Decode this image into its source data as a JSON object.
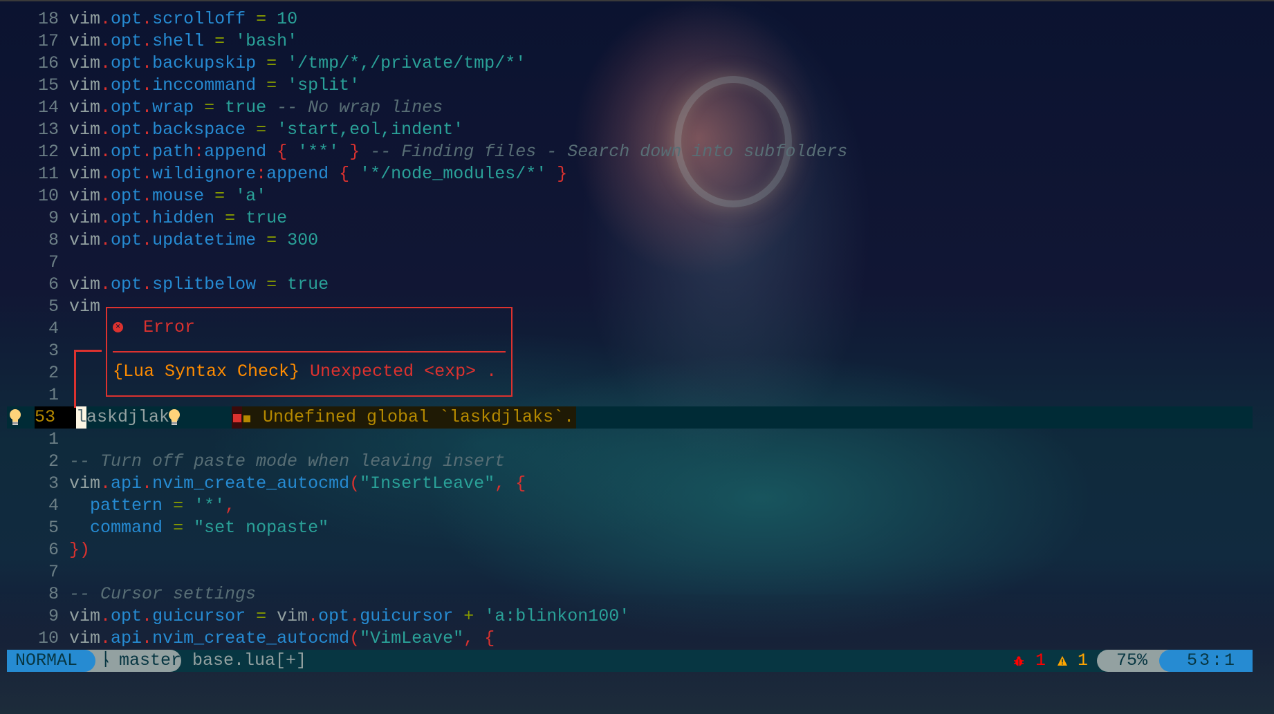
{
  "editor": {
    "lines_above": [
      {
        "num": "18",
        "tokens": [
          [
            "v",
            "vim"
          ],
          [
            "d",
            "."
          ],
          [
            "p",
            "opt"
          ],
          [
            "d",
            "."
          ],
          [
            "p",
            "scrolloff"
          ],
          [
            "v",
            " "
          ],
          [
            "o",
            "="
          ],
          [
            "v",
            " "
          ],
          [
            "s",
            "10"
          ]
        ]
      },
      {
        "num": "17",
        "tokens": [
          [
            "v",
            "vim"
          ],
          [
            "d",
            "."
          ],
          [
            "p",
            "opt"
          ],
          [
            "d",
            "."
          ],
          [
            "p",
            "shell"
          ],
          [
            "v",
            " "
          ],
          [
            "o",
            "="
          ],
          [
            "v",
            " "
          ],
          [
            "s",
            "'bash'"
          ]
        ]
      },
      {
        "num": "16",
        "tokens": [
          [
            "v",
            "vim"
          ],
          [
            "d",
            "."
          ],
          [
            "p",
            "opt"
          ],
          [
            "d",
            "."
          ],
          [
            "p",
            "backupskip"
          ],
          [
            "v",
            " "
          ],
          [
            "o",
            "="
          ],
          [
            "v",
            " "
          ],
          [
            "s",
            "'/tmp/*,/private/tmp/*'"
          ]
        ]
      },
      {
        "num": "15",
        "tokens": [
          [
            "v",
            "vim"
          ],
          [
            "d",
            "."
          ],
          [
            "p",
            "opt"
          ],
          [
            "d",
            "."
          ],
          [
            "p",
            "inccommand"
          ],
          [
            "v",
            " "
          ],
          [
            "o",
            "="
          ],
          [
            "v",
            " "
          ],
          [
            "s",
            "'split'"
          ]
        ]
      },
      {
        "num": "14",
        "tokens": [
          [
            "v",
            "vim"
          ],
          [
            "d",
            "."
          ],
          [
            "p",
            "opt"
          ],
          [
            "d",
            "."
          ],
          [
            "p",
            "wrap"
          ],
          [
            "v",
            " "
          ],
          [
            "o",
            "="
          ],
          [
            "v",
            " "
          ],
          [
            "s",
            "true"
          ],
          [
            "v",
            " "
          ],
          [
            "c",
            "-- No wrap lines"
          ]
        ]
      },
      {
        "num": "13",
        "tokens": [
          [
            "v",
            "vim"
          ],
          [
            "d",
            "."
          ],
          [
            "p",
            "opt"
          ],
          [
            "d",
            "."
          ],
          [
            "p",
            "backspace"
          ],
          [
            "v",
            " "
          ],
          [
            "o",
            "="
          ],
          [
            "v",
            " "
          ],
          [
            "s",
            "'start,eol,indent'"
          ]
        ]
      },
      {
        "num": "12",
        "tokens": [
          [
            "v",
            "vim"
          ],
          [
            "d",
            "."
          ],
          [
            "p",
            "opt"
          ],
          [
            "d",
            "."
          ],
          [
            "p",
            "path"
          ],
          [
            "d",
            ":"
          ],
          [
            "p",
            "append"
          ],
          [
            "v",
            " "
          ],
          [
            "b",
            "{"
          ],
          [
            "v",
            " "
          ],
          [
            "s",
            "'**'"
          ],
          [
            "v",
            " "
          ],
          [
            "b",
            "}"
          ],
          [
            "v",
            " "
          ],
          [
            "c",
            "-- Finding files - Search down into subfolders"
          ]
        ]
      },
      {
        "num": "11",
        "tokens": [
          [
            "v",
            "vim"
          ],
          [
            "d",
            "."
          ],
          [
            "p",
            "opt"
          ],
          [
            "d",
            "."
          ],
          [
            "p",
            "wildignore"
          ],
          [
            "d",
            ":"
          ],
          [
            "p",
            "append"
          ],
          [
            "v",
            " "
          ],
          [
            "b",
            "{"
          ],
          [
            "v",
            " "
          ],
          [
            "s",
            "'*/node_modules/*'"
          ],
          [
            "v",
            " "
          ],
          [
            "b",
            "}"
          ]
        ]
      },
      {
        "num": "10",
        "tokens": [
          [
            "v",
            "vim"
          ],
          [
            "d",
            "."
          ],
          [
            "p",
            "opt"
          ],
          [
            "d",
            "."
          ],
          [
            "p",
            "mouse"
          ],
          [
            "v",
            " "
          ],
          [
            "o",
            "="
          ],
          [
            "v",
            " "
          ],
          [
            "s",
            "'a'"
          ]
        ]
      },
      {
        "num": "9",
        "tokens": [
          [
            "v",
            "vim"
          ],
          [
            "d",
            "."
          ],
          [
            "p",
            "opt"
          ],
          [
            "d",
            "."
          ],
          [
            "p",
            "hidden"
          ],
          [
            "v",
            " "
          ],
          [
            "o",
            "="
          ],
          [
            "v",
            " "
          ],
          [
            "s",
            "true"
          ]
        ]
      },
      {
        "num": "8",
        "tokens": [
          [
            "v",
            "vim"
          ],
          [
            "d",
            "."
          ],
          [
            "p",
            "opt"
          ],
          [
            "d",
            "."
          ],
          [
            "p",
            "updatetime"
          ],
          [
            "v",
            " "
          ],
          [
            "o",
            "="
          ],
          [
            "v",
            " "
          ],
          [
            "s",
            "300"
          ]
        ]
      },
      {
        "num": "7",
        "tokens": []
      },
      {
        "num": "6",
        "tokens": [
          [
            "v",
            "vim"
          ],
          [
            "d",
            "."
          ],
          [
            "p",
            "opt"
          ],
          [
            "d",
            "."
          ],
          [
            "p",
            "splitbelow"
          ],
          [
            "v",
            " "
          ],
          [
            "o",
            "="
          ],
          [
            "v",
            " "
          ],
          [
            "s",
            "true"
          ]
        ]
      },
      {
        "num": "5",
        "tokens": [
          [
            "v",
            "vim"
          ]
        ]
      },
      {
        "num": "4",
        "tokens": []
      },
      {
        "num": "3",
        "tokens": []
      },
      {
        "num": "2",
        "tokens": []
      },
      {
        "num": "1",
        "tokens": []
      }
    ],
    "cursor_line": {
      "num": "53",
      "cursor_char": "l",
      "rest_text": "askdjlaks",
      "diagnostic_text": "Undefined global `laskdjlaks`."
    },
    "lines_below": [
      {
        "num": "1",
        "tokens": []
      },
      {
        "num": "2",
        "tokens": [
          [
            "c",
            "-- Turn off paste mode when leaving insert"
          ]
        ]
      },
      {
        "num": "3",
        "tokens": [
          [
            "v",
            "vim"
          ],
          [
            "d",
            "."
          ],
          [
            "p",
            "api"
          ],
          [
            "d",
            "."
          ],
          [
            "p",
            "nvim_create_autocmd"
          ],
          [
            "b",
            "("
          ],
          [
            "s",
            "\"InsertLeave\""
          ],
          [
            "d",
            ","
          ],
          [
            "v",
            " "
          ],
          [
            "b",
            "{"
          ]
        ]
      },
      {
        "num": "4",
        "tokens": [
          [
            "v",
            "  "
          ],
          [
            "p",
            "pattern"
          ],
          [
            "v",
            " "
          ],
          [
            "o",
            "="
          ],
          [
            "v",
            " "
          ],
          [
            "s",
            "'*'"
          ],
          [
            "d",
            ","
          ]
        ]
      },
      {
        "num": "5",
        "tokens": [
          [
            "v",
            "  "
          ],
          [
            "p",
            "command"
          ],
          [
            "v",
            " "
          ],
          [
            "o",
            "="
          ],
          [
            "v",
            " "
          ],
          [
            "s",
            "\"set nopaste\""
          ]
        ]
      },
      {
        "num": "6",
        "tokens": [
          [
            "b",
            "})"
          ]
        ]
      },
      {
        "num": "7",
        "tokens": []
      },
      {
        "num": "8",
        "tokens": [
          [
            "c",
            "-- Cursor settings"
          ]
        ]
      },
      {
        "num": "9",
        "tokens": [
          [
            "v",
            "vim"
          ],
          [
            "d",
            "."
          ],
          [
            "p",
            "opt"
          ],
          [
            "d",
            "."
          ],
          [
            "p",
            "guicursor"
          ],
          [
            "v",
            " "
          ],
          [
            "o",
            "="
          ],
          [
            "v",
            " vim"
          ],
          [
            "d",
            "."
          ],
          [
            "p",
            "opt"
          ],
          [
            "d",
            "."
          ],
          [
            "p",
            "guicursor"
          ],
          [
            "v",
            " "
          ],
          [
            "o",
            "+"
          ],
          [
            "v",
            " "
          ],
          [
            "s",
            "'a:blinkon100'"
          ]
        ]
      },
      {
        "num": "10",
        "tokens": [
          [
            "v",
            "vim"
          ],
          [
            "d",
            "."
          ],
          [
            "p",
            "api"
          ],
          [
            "d",
            "."
          ],
          [
            "p",
            "nvim_create_autocmd"
          ],
          [
            "b",
            "("
          ],
          [
            "s",
            "\"VimLeave\""
          ],
          [
            "d",
            ","
          ],
          [
            "v",
            " "
          ],
          [
            "b",
            "{"
          ]
        ]
      }
    ]
  },
  "popup": {
    "icon": "error-circle-icon",
    "title": "Error",
    "source": "{Lua Syntax Check}",
    "message": " Unexpected <exp> ."
  },
  "statusline": {
    "mode": "NORMAL",
    "branch_icon": "git-branch-icon",
    "branch": "master",
    "file": "base.lua[+]",
    "errors": "1",
    "warnings": "1",
    "percent": "75%",
    "position": "53:1"
  },
  "colors": {
    "error": "#dc322f",
    "warning": "#b58900",
    "accent_blue": "#268bd2",
    "statusline_bg": "#073642",
    "cursorline_bg": "#002b36"
  }
}
